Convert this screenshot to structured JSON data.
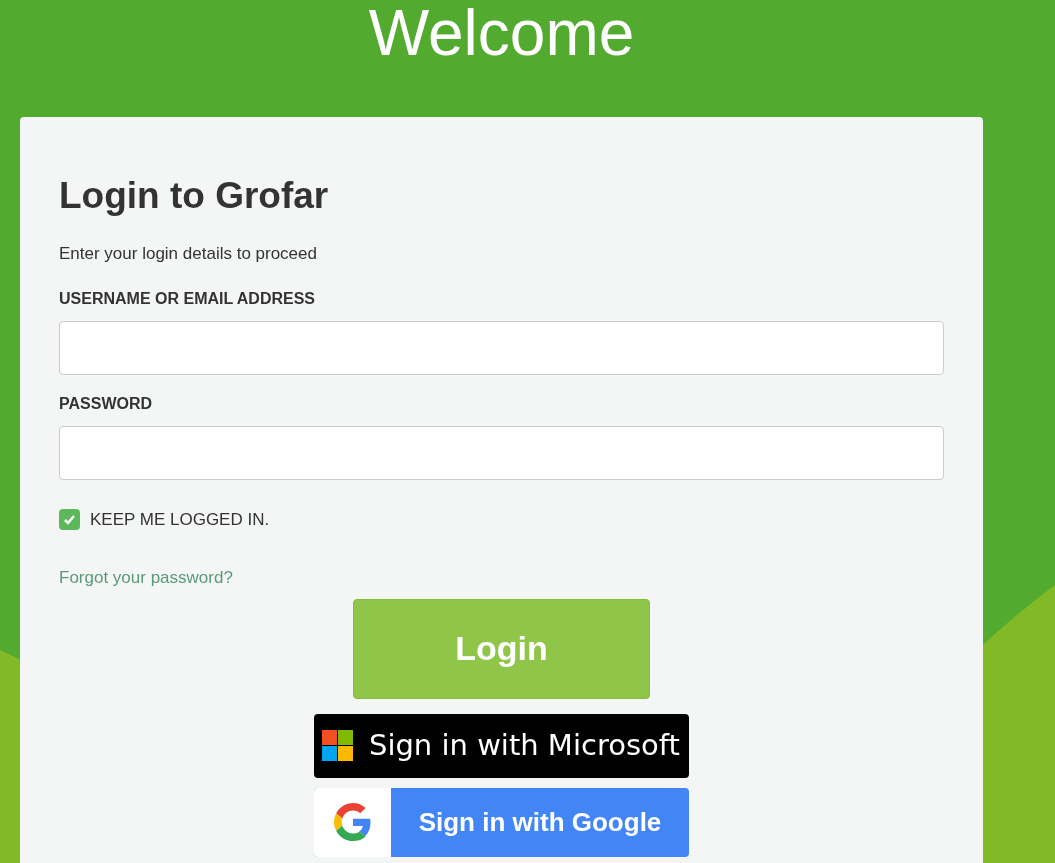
{
  "hero": {
    "title": "Welcome"
  },
  "card": {
    "title": "Login to Grofar",
    "subtitle": "Enter your login details to proceed",
    "fields": [
      {
        "label": "USERNAME OR EMAIL ADDRESS"
      },
      {
        "label": "PASSWORD"
      }
    ],
    "keep_logged_in": {
      "label": "KEEP ME LOGGED IN.",
      "checked": true
    },
    "forgot_link": "Forgot your password?",
    "login_button": "Login",
    "social_buttons": [
      {
        "kind": "microsoft",
        "label": "Sign in with Microsoft"
      },
      {
        "kind": "google",
        "label": "Sign in with Google"
      }
    ]
  }
}
